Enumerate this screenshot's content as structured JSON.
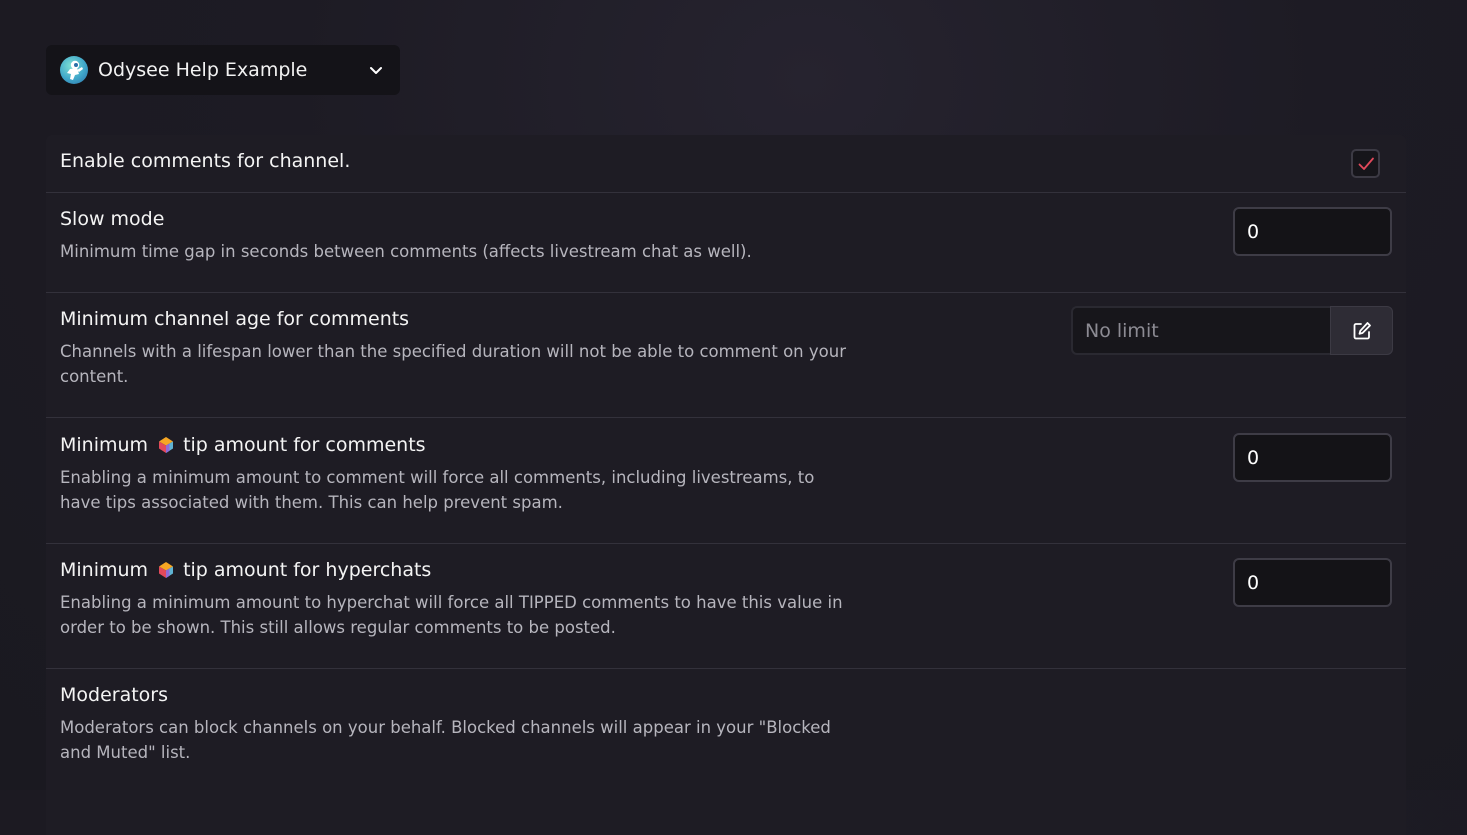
{
  "channel_selector": {
    "name": "Odysee Help Example"
  },
  "settings": {
    "enable_comments": {
      "label": "Enable comments for channel.",
      "checked": true
    },
    "slow_mode": {
      "title": "Slow mode",
      "description": "Minimum time gap in seconds between comments (affects livestream chat as well).",
      "value": "0"
    },
    "min_channel_age": {
      "title": "Minimum channel age for comments",
      "description": "Channels with a lifespan lower than the specified duration will not be able to comment on your content.",
      "placeholder": "No limit"
    },
    "min_tip_comments": {
      "title_prefix": "Minimum",
      "title_suffix": "tip amount for comments",
      "description": "Enabling a minimum amount to comment will force all comments, including livestreams, to have tips associated with them. This can help prevent spam.",
      "value": "0"
    },
    "min_tip_hyperchats": {
      "title_prefix": "Minimum",
      "title_suffix": "tip amount for hyperchats",
      "description": "Enabling a minimum amount to hyperchat will force all TIPPED comments to have this value in order to be shown. This still allows regular comments to be posted.",
      "value": "0"
    },
    "moderators": {
      "title": "Moderators",
      "description": "Moderators can block channels on your behalf. Blocked channels will appear in your \"Blocked and Muted\" list."
    }
  },
  "icons": {
    "avatar": "spaceman-avatar-icon",
    "chevron": "chevron-down-icon",
    "check": "check-icon",
    "edit": "edit-icon",
    "credits": "lbc-credits-icon"
  },
  "colors": {
    "check_accent": "#e2495b",
    "background": "#1c1a23",
    "card": "#1e1c24"
  }
}
